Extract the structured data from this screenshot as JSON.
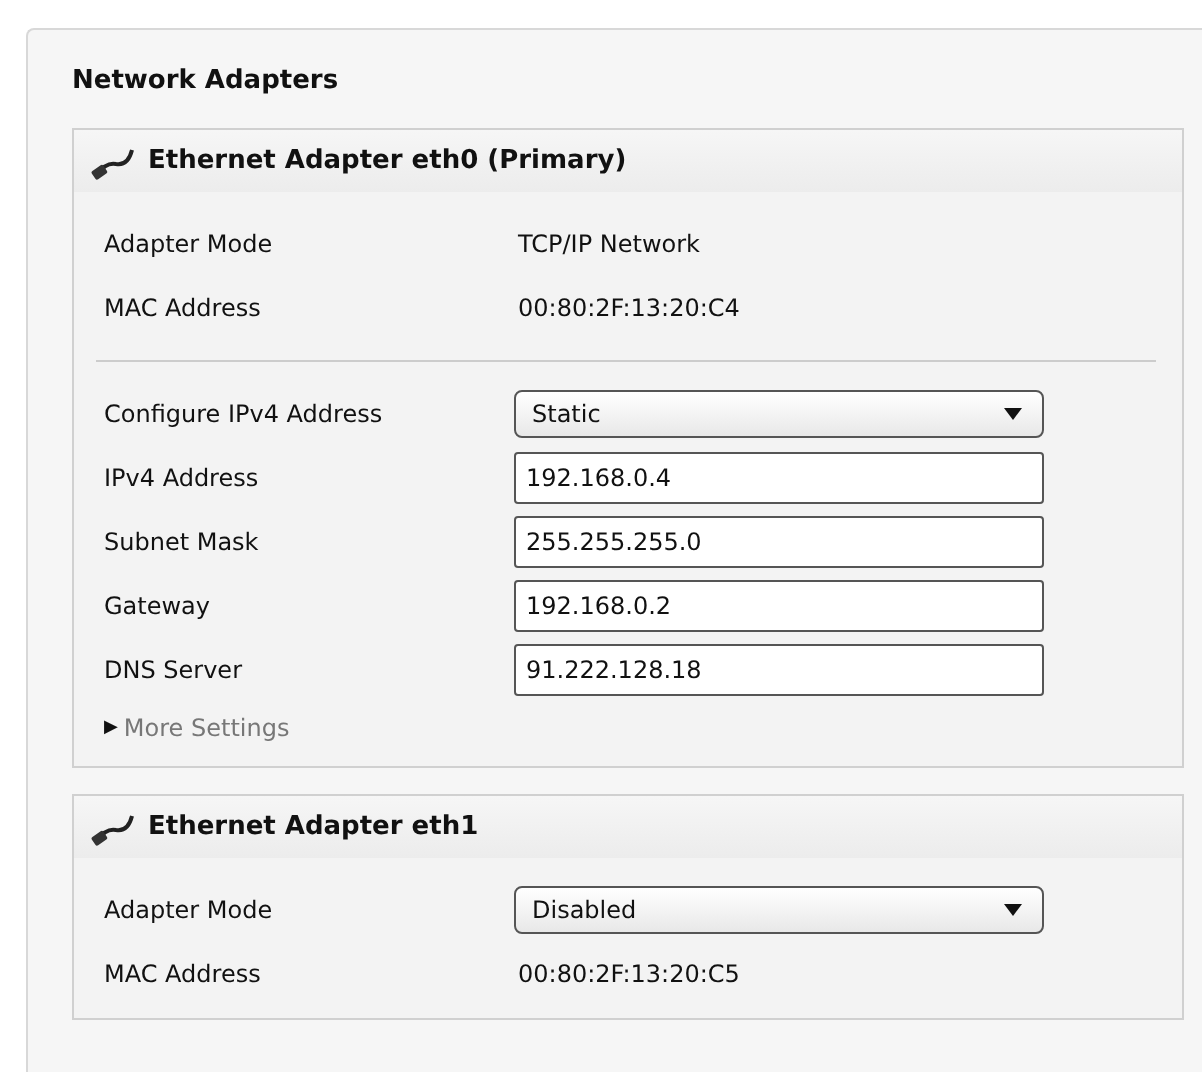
{
  "panel": {
    "title": "Network Adapters"
  },
  "adapters": [
    {
      "title": "Ethernet Adapter eth0 (Primary)",
      "groups": [
        [
          {
            "kind": "text",
            "label": "Adapter Mode",
            "value": "TCP/IP Network"
          },
          {
            "kind": "text",
            "label": "MAC Address",
            "value": "00:80:2F:13:20:C4"
          }
        ],
        [
          {
            "kind": "select",
            "label": "Configure IPv4 Address",
            "value": "Static"
          },
          {
            "kind": "input",
            "label": "IPv4 Address",
            "value": "192.168.0.4"
          },
          {
            "kind": "input",
            "label": "Subnet Mask",
            "value": "255.255.255.0"
          },
          {
            "kind": "input",
            "label": "Gateway",
            "value": "192.168.0.2"
          },
          {
            "kind": "input",
            "label": "DNS Server",
            "value": "91.222.128.18"
          }
        ]
      ],
      "more": {
        "label": "More Settings",
        "arrow": "▶",
        "expanded": false
      }
    },
    {
      "title": "Ethernet Adapter eth1",
      "groups": [
        [
          {
            "kind": "select",
            "label": "Adapter Mode",
            "value": "Disabled"
          },
          {
            "kind": "text",
            "label": "MAC Address",
            "value": "00:80:2F:13:20:C5"
          }
        ]
      ]
    }
  ]
}
